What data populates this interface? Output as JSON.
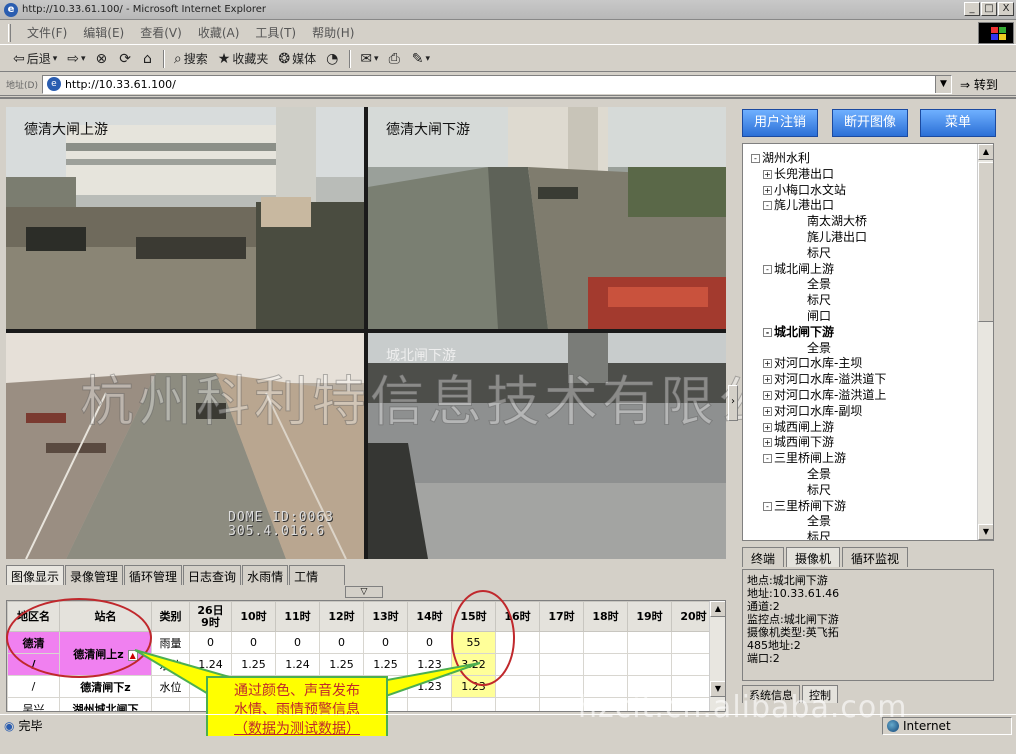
{
  "window": {
    "title": "http://10.33.61.100/ - Microsoft Internet Explorer",
    "minimize": "_",
    "maximize": "□",
    "close": "X"
  },
  "menu": [
    "文件(F)",
    "编辑(E)",
    "查看(V)",
    "收藏(A)",
    "工具(T)",
    "帮助(H)"
  ],
  "toolbar": {
    "back": "后退",
    "search": "搜索",
    "favorites": "收藏夹",
    "media": "媒体"
  },
  "address": {
    "label": "地址(D)",
    "url": "http://10.33.61.100/",
    "go": "转到"
  },
  "video": {
    "labels": [
      "德清大闸上游",
      "德清大闸下游",
      "",
      "城北闸下游"
    ],
    "dome_id_line1": "DOME ID:0063",
    "dome_id_line2": "305.4.016.6",
    "watermark": "杭州科利特信息技术有限公司"
  },
  "panel_buttons": {
    "logout": "用户注销",
    "disconnect": "断开图像",
    "menu": "菜单"
  },
  "tree": [
    {
      "label": "湖州水利",
      "depth": 0,
      "expander": "-",
      "bold": false
    },
    {
      "label": "长兜港出口",
      "depth": 1,
      "expander": "+",
      "bold": false
    },
    {
      "label": "小梅口水文站",
      "depth": 1,
      "expander": "+",
      "bold": false
    },
    {
      "label": "旄儿港出口",
      "depth": 1,
      "expander": "-",
      "bold": false
    },
    {
      "label": "南太湖大桥",
      "depth": 2,
      "expander": "",
      "bold": false
    },
    {
      "label": "旄儿港出口",
      "depth": 2,
      "expander": "",
      "bold": false
    },
    {
      "label": "标尺",
      "depth": 2,
      "expander": "",
      "bold": false
    },
    {
      "label": "城北闸上游",
      "depth": 1,
      "expander": "-",
      "bold": false
    },
    {
      "label": "全景",
      "depth": 2,
      "expander": "",
      "bold": false
    },
    {
      "label": "标尺",
      "depth": 2,
      "expander": "",
      "bold": false
    },
    {
      "label": "闸口",
      "depth": 2,
      "expander": "",
      "bold": false
    },
    {
      "label": "城北闸下游",
      "depth": 1,
      "expander": "-",
      "bold": true
    },
    {
      "label": "全景",
      "depth": 2,
      "expander": "",
      "bold": false
    },
    {
      "label": "对河口水库-主坝",
      "depth": 1,
      "expander": "+",
      "bold": false
    },
    {
      "label": "对河口水库-溢洪道下",
      "depth": 1,
      "expander": "+",
      "bold": false
    },
    {
      "label": "对河口水库-溢洪道上",
      "depth": 1,
      "expander": "+",
      "bold": false
    },
    {
      "label": "对河口水库-副坝",
      "depth": 1,
      "expander": "+",
      "bold": false
    },
    {
      "label": "城西闸上游",
      "depth": 1,
      "expander": "+",
      "bold": false
    },
    {
      "label": "城西闸下游",
      "depth": 1,
      "expander": "+",
      "bold": false
    },
    {
      "label": "三里桥闸上游",
      "depth": 1,
      "expander": "-",
      "bold": false
    },
    {
      "label": "全景",
      "depth": 2,
      "expander": "",
      "bold": false
    },
    {
      "label": "标尺",
      "depth": 2,
      "expander": "",
      "bold": false
    },
    {
      "label": "三里桥闸下游",
      "depth": 1,
      "expander": "-",
      "bold": false
    },
    {
      "label": "全景",
      "depth": 2,
      "expander": "",
      "bold": false
    },
    {
      "label": "标尺",
      "depth": 2,
      "expander": "",
      "bold": false
    }
  ],
  "right_tabs": [
    "终端",
    "摄像机",
    "循环监视"
  ],
  "info_lines": [
    "地点:城北闸下游",
    "地址:10.33.61.46",
    "通道:2",
    "监控点:城北闸下游",
    "摄像机类型:英飞拓",
    "485地址:2",
    "端口:2"
  ],
  "right_bottom_tabs": [
    "系统信息",
    "控制"
  ],
  "func_tabs": [
    "图像显示",
    "录像管理",
    "循环管理",
    "日志查询",
    "水雨情",
    "工情"
  ],
  "collapse_glyph": "▽",
  "table": {
    "headers": [
      "地区名",
      "站名",
      "类别",
      "26日\n9时",
      "10时",
      "11时",
      "12时",
      "13时",
      "14时",
      "15时",
      "16时",
      "17时",
      "18时",
      "19时",
      "20时"
    ],
    "rows": [
      {
        "region": "德清",
        "site": "德清闸上z",
        "type": "雨量",
        "values": [
          "0",
          "0",
          "0",
          "0",
          "0",
          "0",
          "55",
          "",
          "",
          "",
          "",
          ""
        ]
      },
      {
        "region": "/",
        "site": "",
        "type": "水位",
        "values": [
          "1.24",
          "1.25",
          "1.24",
          "1.25",
          "1.25",
          "1.23",
          "3.22",
          "",
          "",
          "",
          "",
          ""
        ]
      },
      {
        "region": "/",
        "site": "德清闸下z",
        "type": "水位",
        "values": [
          "1.",
          "",
          "",
          "",
          "2",
          "1.23",
          "1.23",
          "",
          "",
          "",
          "",
          ""
        ]
      },
      {
        "region": "吴兴",
        "site": "湖州城北闸下",
        "type": "",
        "values": [
          "",
          "",
          "",
          "",
          "",
          "",
          "",
          "",
          "",
          "",
          "",
          ""
        ]
      }
    ]
  },
  "callout": {
    "line1": "通过颜色、声音发布",
    "line2": "水情、雨情预警信息",
    "line3": "（数据为测试数据）"
  },
  "site_watermark": "hzcit.cn.alibaba.com",
  "status": {
    "text": "完毕",
    "zone": "Internet"
  }
}
